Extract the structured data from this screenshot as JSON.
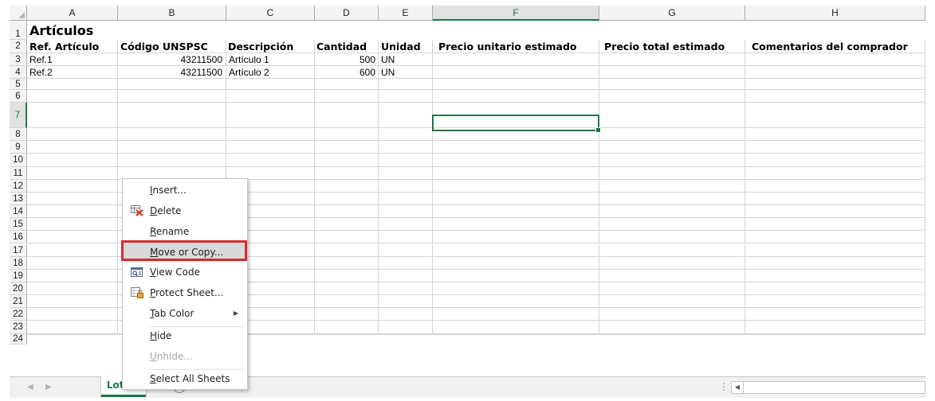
{
  "columns": [
    "A",
    "B",
    "C",
    "D",
    "E",
    "F",
    "G",
    "H"
  ],
  "selected_column": "F",
  "rows": [
    "1",
    "2",
    "3",
    "4",
    "5",
    "6",
    "7",
    "8",
    "9",
    "10",
    "11",
    "12",
    "13",
    "14",
    "15",
    "16",
    "17",
    "18",
    "19",
    "20",
    "21",
    "22",
    "23",
    "24"
  ],
  "selected_row": "7",
  "sheet": {
    "title": "Artículos",
    "headers": [
      "Ref. Artículo",
      "Código UNSPSC",
      "Descripción",
      "Cantidad",
      "Unidad",
      "Precio unitario estimado",
      "Precio total estimado",
      "Comentarios del comprador"
    ],
    "data": [
      {
        "ref": "Ref.1",
        "code": "43211500",
        "desc": "Artículo 1",
        "qty": "500",
        "unit": "UN"
      },
      {
        "ref": "Ref.2",
        "code": "43211500",
        "desc": "Artículo 2",
        "qty": "600",
        "unit": "UN"
      }
    ]
  },
  "context_menu": {
    "items": [
      {
        "label": "Insert...",
        "disabled": false,
        "icon": ""
      },
      {
        "label": "Delete",
        "disabled": false,
        "icon": "delete-sheet-icon"
      },
      {
        "label": "Rename",
        "disabled": false,
        "icon": ""
      },
      {
        "label": "Move or Copy...",
        "disabled": false,
        "icon": "",
        "highlighted": true
      },
      {
        "label": "View Code",
        "disabled": false,
        "icon": "view-code-icon"
      },
      {
        "label": "Protect Sheet...",
        "disabled": false,
        "icon": "protect-sheet-icon"
      },
      {
        "label": "Tab Color",
        "disabled": false,
        "icon": "",
        "submenu": true
      },
      {
        "label": "Hide",
        "disabled": false,
        "icon": ""
      },
      {
        "label": "Unhide...",
        "disabled": true,
        "icon": ""
      },
      {
        "label": "Select All Sheets",
        "disabled": false,
        "icon": ""
      }
    ]
  },
  "tabs": {
    "active": "Lote 1",
    "add": "+"
  },
  "colors": {
    "excel_green": "#217346",
    "callout_red": "#d32e2e"
  }
}
